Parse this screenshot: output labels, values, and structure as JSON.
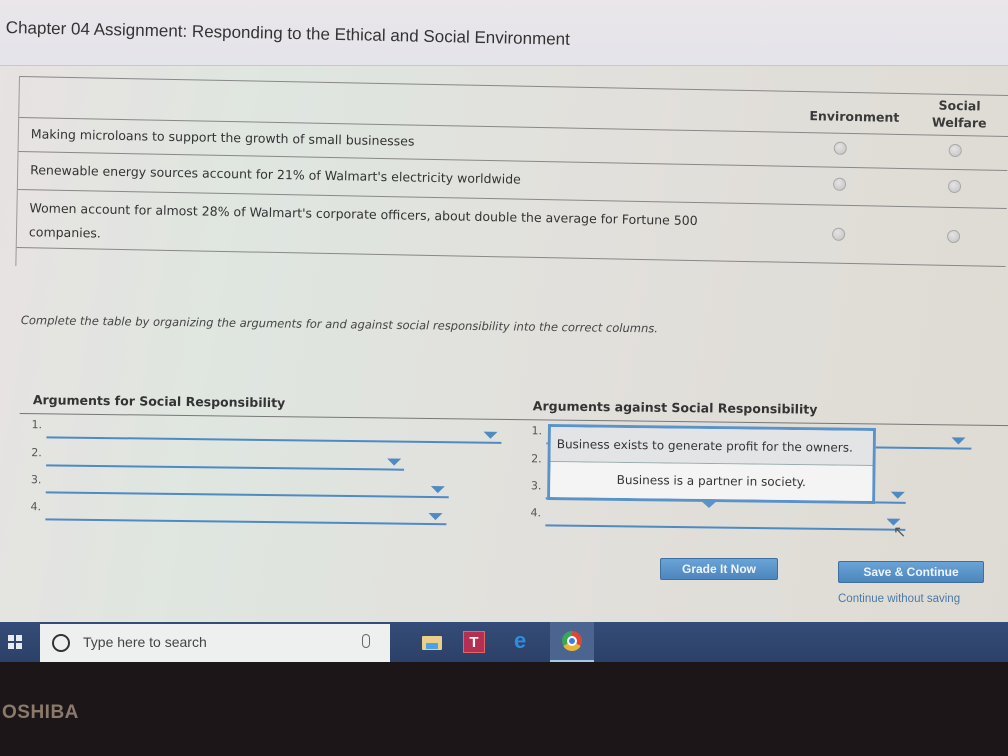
{
  "title": "Chapter 04 Assignment: Responding to the Ethical and Social Environment",
  "top_table": {
    "columns": [
      "Environment",
      "Social Welfare"
    ],
    "column_soc_line1": "Social",
    "column_soc_line2": "Welfare",
    "rows": [
      {
        "statement": "Making microloans to support the growth of small businesses",
        "environment": false,
        "social_welfare": false
      },
      {
        "statement": "Renewable energy sources account for 21% of Walmart's electricity worldwide",
        "environment": false,
        "social_welfare": false
      },
      {
        "statement": "Women account for almost 28% of Walmart's corporate officers, about double the average for Fortune 500 companies.",
        "environment": false,
        "social_welfare": false
      }
    ]
  },
  "instructions": "Complete the table by organizing the arguments for and against social responsibility into the correct columns.",
  "arguments_for": {
    "title": "Arguments for Social Responsibility",
    "slots": [
      {
        "num": "1.",
        "value": ""
      },
      {
        "num": "2.",
        "value": ""
      },
      {
        "num": "3.",
        "value": ""
      },
      {
        "num": "4.",
        "value": ""
      }
    ]
  },
  "arguments_against": {
    "title": "Arguments against Social Responsibility",
    "slots": [
      {
        "num": "1.",
        "value": ""
      },
      {
        "num": "2.",
        "value": ""
      },
      {
        "num": "3.",
        "value": ""
      },
      {
        "num": "4.",
        "value": ""
      }
    ]
  },
  "dropdown_popup": {
    "options": [
      "Business exists to generate profit for the owners.",
      "Business is a partner in society."
    ],
    "highlighted_index": 0
  },
  "buttons": {
    "grade": "Grade It Now",
    "save": "Save & Continue",
    "continue_link": "Continue without saving"
  },
  "taskbar": {
    "search_placeholder": "Type here to search",
    "apps": [
      "file-explorer",
      "t-app",
      "edge",
      "chrome"
    ],
    "t_label": "T",
    "edge_label": "e"
  },
  "bezel_brand": "OSHIBA"
}
